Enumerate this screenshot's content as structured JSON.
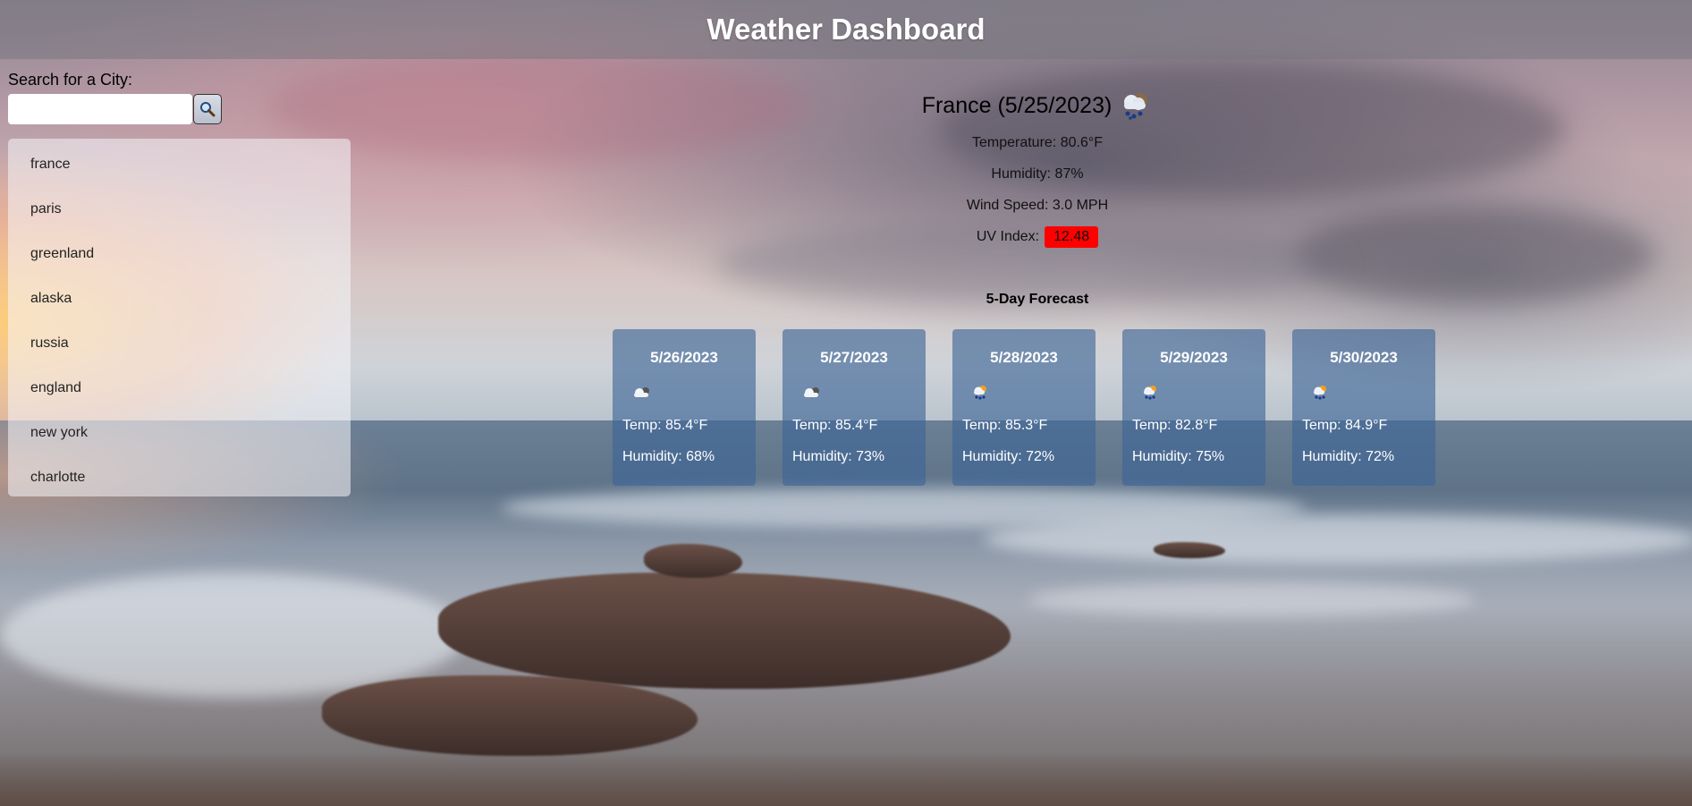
{
  "header": {
    "title": "Weather Dashboard"
  },
  "search": {
    "label": "Search for a City:",
    "value": "",
    "placeholder": "",
    "button_icon": "magnifier-icon"
  },
  "history": {
    "items": [
      "france",
      "paris",
      "greenland",
      "alaska",
      "russia",
      "england",
      "new york",
      "charlotte"
    ]
  },
  "current": {
    "title": "France (5/25/2023)",
    "icon": "rain-cloud-icon",
    "temperature": "Temperature: 80.6°F",
    "humidity": "Humidity: 87%",
    "wind": "Wind Speed: 3.0 MPH",
    "uv_label": "UV Index:",
    "uv_value": "12.48",
    "uv_color": "#ff0000"
  },
  "forecast": {
    "title": "5-Day Forecast",
    "days": [
      {
        "date": "5/26/2023",
        "icon": "partly-cloudy-icon",
        "temp": "Temp: 85.4°F",
        "humidity": "Humidity: 68%"
      },
      {
        "date": "5/27/2023",
        "icon": "partly-cloudy-icon",
        "temp": "Temp: 85.4°F",
        "humidity": "Humidity: 73%"
      },
      {
        "date": "5/28/2023",
        "icon": "sun-rain-icon",
        "temp": "Temp: 85.3°F",
        "humidity": "Humidity: 72%"
      },
      {
        "date": "5/29/2023",
        "icon": "sun-rain-icon",
        "temp": "Temp: 82.8°F",
        "humidity": "Humidity: 75%"
      },
      {
        "date": "5/30/2023",
        "icon": "sun-rain-icon",
        "temp": "Temp: 84.9°F",
        "humidity": "Humidity: 72%"
      }
    ]
  },
  "colors": {
    "card_bg": "#3c6496",
    "header_bg": "#78767f"
  }
}
